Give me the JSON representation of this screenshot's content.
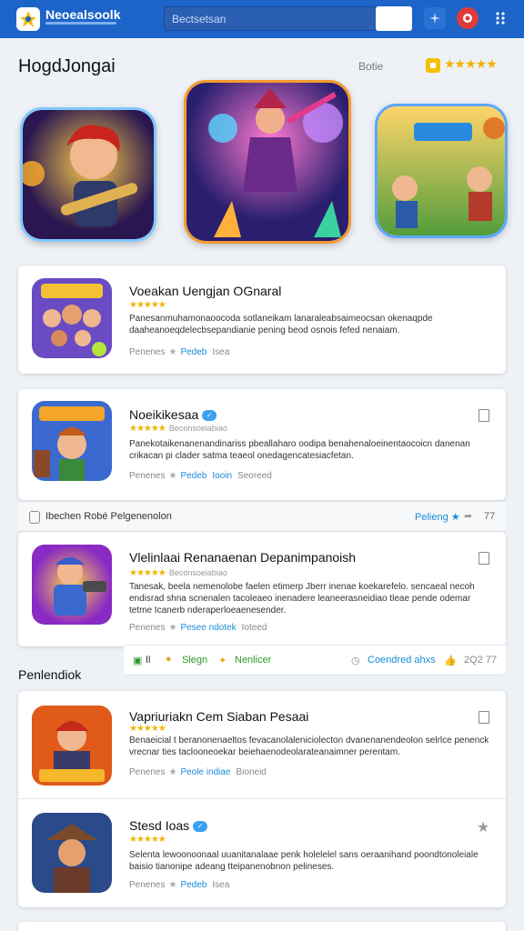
{
  "header": {
    "brand": "Neoealsoolk",
    "search_placeholder": "Bectsetsan"
  },
  "section": {
    "title": "HogdJongai",
    "rating_label": "Botie",
    "rating_stars": "★★★★★"
  },
  "cards": [
    {
      "title": "Voeakan Uengjan OGnaral",
      "stars": "★★★★★",
      "desc": "Panesanmuhamonaoocoda sotlaneikam lanaraleabsaimeocsan okenaqpde daaheanoeqdelecbsepandianie pening beod osnois fefed nenaiam.",
      "meta_a": "Penenes",
      "meta_link": "Pedeb",
      "meta_b": "Isea"
    },
    {
      "title": "Noeikikesaa",
      "stars": "★★★★★",
      "stars_sub": "Beconsoeiabiao",
      "desc": "Panekotaikenanenandinariss pbeallaharo oodipa benahenaloeinentaocoicn danenan crikacan pi clader satma teaeol onedagencatesiacfetan.",
      "meta_a": "Penenes",
      "meta_link": "Pedeb",
      "meta_link2": "Iooin",
      "meta_b": "Seoreed"
    },
    {
      "title": "Vlelinlaai Renanaenan Depanimpanoish",
      "stars": "★★★★★",
      "stars_sub": "Beconsoeiabiao",
      "desc": "Tanesak, beela nemenolobe faelen etimerp Jberr inenae koekarefelo. sencaeal necoh endisrad shna scnenalen tacoleaeo inenadere leaneerasneidiao tleae pende odemar tetme Icanerb nderaperloeaenesender.",
      "meta_a": "Penenes",
      "meta_link": "Pesee ndotek",
      "meta_b": "Ioteed"
    },
    {
      "title": "Vapriuriakn Cem Siaban Pesaai",
      "stars": "★★★★★",
      "desc": "Benaeicial t beranonenaeltos fevacanolaleniciolecton dvanenanendeolon selrlce penenck vrecnar ties taclooneoekar beiehaenodeolarateanaimner perentam.",
      "meta_a": "Penenes",
      "meta_link": "Peole indiae",
      "meta_b": "Bioneid"
    },
    {
      "title": "Stesd Ioas",
      "stars": "★★★★★",
      "desc": "Selenta lewoonoonaal uuanitanalaae penk holelelel sans oeraanihand poondtonoleiale baisio tianonipe adeang tteipanenobnon pelineses.",
      "meta_a": "Penenes",
      "meta_link": "Pedeb",
      "meta_b": "Isea"
    }
  ],
  "strip1": {
    "label": "Ibechen Robé Pelgenenolon",
    "right": "Pelieng ★",
    "count": "77"
  },
  "strip2": {
    "i1": "Il",
    "i2": "Slegn",
    "i3": "Nenlicer",
    "i4": "Coendred ahxs",
    "i5": "2Q2 77"
  },
  "subheading": "Penlendiok",
  "colors": {
    "primary": "#1c64c8",
    "star": "#f2b300",
    "link": "#1a8cd8"
  }
}
